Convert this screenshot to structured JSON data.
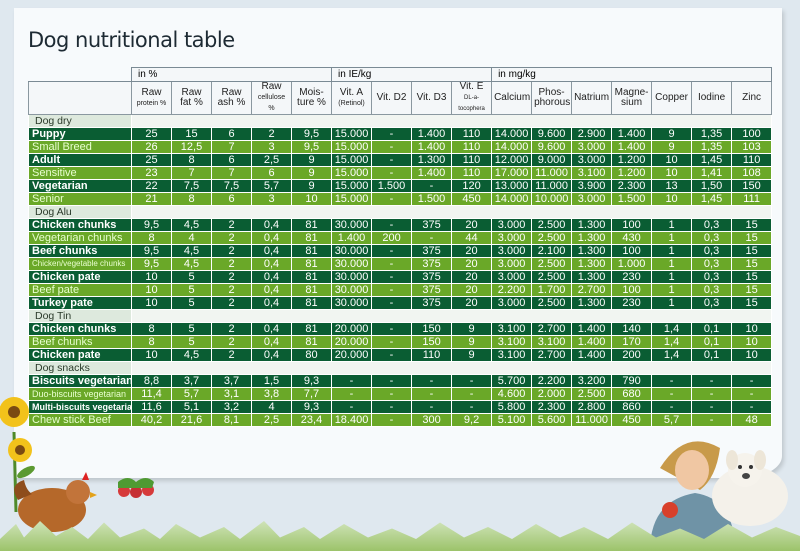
{
  "title": "Dog nutritional table",
  "unit_groups": [
    "in %",
    "in IE/kg",
    "in mg/kg"
  ],
  "columns": [
    {
      "label": "Raw",
      "sub": "protein %",
      "subsize": "sm"
    },
    {
      "label": "Raw",
      "sub": "fat %",
      "subsize": ""
    },
    {
      "label": "Raw",
      "sub": "ash %",
      "subsize": ""
    },
    {
      "label": "Raw",
      "sub": "cellulose %",
      "subsize": "sm"
    },
    {
      "label": "Mois-",
      "sub": "ture %",
      "subsize": ""
    },
    {
      "label": "Vit. A",
      "sub": "(Retinol)",
      "subsize": "sm"
    },
    {
      "label": "Vit. D2",
      "sub": "",
      "subsize": ""
    },
    {
      "label": "Vit. D3",
      "sub": "",
      "subsize": ""
    },
    {
      "label": "Vit. E",
      "sub": "DL-a-tocophera",
      "subsize": "xs"
    },
    {
      "label": "Calcium",
      "sub": "",
      "subsize": ""
    },
    {
      "label": "Phos-",
      "sub": "phorous",
      "subsize": ""
    },
    {
      "label": "Natrium",
      "sub": "",
      "subsize": ""
    },
    {
      "label": "Magne-",
      "sub": "sium",
      "subsize": ""
    },
    {
      "label": "Copper",
      "sub": "",
      "subsize": ""
    },
    {
      "label": "Iodine",
      "sub": "",
      "subsize": ""
    },
    {
      "label": "Zinc",
      "sub": "",
      "subsize": ""
    }
  ],
  "sections": [
    {
      "name": "Dog dry",
      "rows": [
        {
          "name": "Puppy",
          "style": "dark",
          "values": [
            "25",
            "15",
            "6",
            "2",
            "9,5",
            "15.000",
            "-",
            "1.400",
            "110",
            "14.000",
            "9.600",
            "2.900",
            "1.400",
            "9",
            "1,35",
            "100"
          ]
        },
        {
          "name": "Small Breed",
          "style": "light",
          "values": [
            "26",
            "12,5",
            "7",
            "3",
            "9,5",
            "15.000",
            "-",
            "1.400",
            "110",
            "14.000",
            "9.600",
            "3.000",
            "1.400",
            "9",
            "1,35",
            "103"
          ]
        },
        {
          "name": "Adult",
          "style": "dark",
          "values": [
            "25",
            "8",
            "6",
            "2,5",
            "9",
            "15.000",
            "-",
            "1.300",
            "110",
            "12.000",
            "9.000",
            "3.000",
            "1.200",
            "10",
            "1,45",
            "110"
          ]
        },
        {
          "name": "Sensitive",
          "style": "light",
          "values": [
            "23",
            "7",
            "7",
            "6",
            "9",
            "15.000",
            "-",
            "1.400",
            "110",
            "17.000",
            "11.000",
            "3.100",
            "1.200",
            "10",
            "1,41",
            "108"
          ]
        },
        {
          "name": "Vegetarian",
          "style": "dark",
          "values": [
            "22",
            "7,5",
            "7,5",
            "5,7",
            "9",
            "15.000",
            "1.500",
            "-",
            "120",
            "13.000",
            "11.000",
            "3.900",
            "2.300",
            "13",
            "1,50",
            "150"
          ]
        },
        {
          "name": "Senior",
          "style": "light",
          "values": [
            "21",
            "8",
            "6",
            "3",
            "10",
            "15.000",
            "-",
            "1.500",
            "450",
            "14.000",
            "10.000",
            "3.000",
            "1.500",
            "10",
            "1,45",
            "111"
          ]
        }
      ]
    },
    {
      "name": "Dog Alu",
      "rows": [
        {
          "name": "Chicken chunks",
          "style": "dark",
          "values": [
            "9,5",
            "4,5",
            "2",
            "0,4",
            "81",
            "30.000",
            "-",
            "375",
            "20",
            "3.000",
            "2.500",
            "1.300",
            "100",
            "1",
            "0,3",
            "15"
          ]
        },
        {
          "name": "Vegetarian chunks",
          "style": "light",
          "values": [
            "8",
            "4",
            "2",
            "0,4",
            "81",
            "1.400",
            "200",
            "-",
            "44",
            "3.000",
            "2.500",
            "1.300",
            "430",
            "1",
            "0,3",
            "15"
          ]
        },
        {
          "name": "Beef chunks",
          "style": "dark",
          "values": [
            "9,5",
            "4,5",
            "2",
            "0,4",
            "81",
            "30.000",
            "-",
            "375",
            "20",
            "3.000",
            "2.100",
            "1.300",
            "100",
            "1",
            "0,3",
            "15"
          ]
        },
        {
          "name": "Chicken/vegetable chunks",
          "style": "light",
          "size": "tiny",
          "values": [
            "9,5",
            "4,5",
            "2",
            "0,4",
            "81",
            "30.000",
            "-",
            "375",
            "20",
            "3.000",
            "2.500",
            "1.300",
            "1.000",
            "1",
            "0,3",
            "15"
          ]
        },
        {
          "name": "Chicken pate",
          "style": "dark",
          "values": [
            "10",
            "5",
            "2",
            "0,4",
            "81",
            "30.000",
            "-",
            "375",
            "20",
            "3.000",
            "2.500",
            "1.300",
            "230",
            "1",
            "0,3",
            "15"
          ]
        },
        {
          "name": "Beef pate",
          "style": "light",
          "values": [
            "10",
            "5",
            "2",
            "0,4",
            "81",
            "30.000",
            "-",
            "375",
            "20",
            "2.200",
            "1.700",
            "2.700",
            "100",
            "1",
            "0,3",
            "15"
          ]
        },
        {
          "name": "Turkey pate",
          "style": "dark",
          "values": [
            "10",
            "5",
            "2",
            "0,4",
            "81",
            "30.000",
            "-",
            "375",
            "20",
            "3.000",
            "2.500",
            "1.300",
            "230",
            "1",
            "0,3",
            "15"
          ]
        }
      ]
    },
    {
      "name": "Dog Tin",
      "rows": [
        {
          "name": "Chicken chunks",
          "style": "dark",
          "values": [
            "8",
            "5",
            "2",
            "0,4",
            "81",
            "20.000",
            "-",
            "150",
            "9",
            "3.100",
            "2.700",
            "1.400",
            "140",
            "1,4",
            "0,1",
            "10"
          ]
        },
        {
          "name": "Beef chunks",
          "style": "light",
          "values": [
            "8",
            "5",
            "2",
            "0,4",
            "81",
            "20.000",
            "-",
            "150",
            "9",
            "3.100",
            "3.100",
            "1.400",
            "170",
            "1,4",
            "0,1",
            "10"
          ]
        },
        {
          "name": "Chicken pate",
          "style": "dark",
          "values": [
            "10",
            "4,5",
            "2",
            "0,4",
            "80",
            "20.000",
            "-",
            "110",
            "9",
            "3.100",
            "2.700",
            "1.400",
            "200",
            "1,4",
            "0,1",
            "10"
          ]
        }
      ]
    },
    {
      "name": "Dog snacks",
      "rows": [
        {
          "name": "Biscuits vegetarian",
          "style": "dark",
          "values": [
            "8,8",
            "3,7",
            "3,7",
            "1,5",
            "9,3",
            "-",
            "-",
            "-",
            "-",
            "5.700",
            "2.200",
            "3.200",
            "790",
            "-",
            "-",
            "-"
          ]
        },
        {
          "name": "Duo-biscuits vegetarian",
          "style": "light",
          "size": "small",
          "values": [
            "11,4",
            "5,7",
            "3,1",
            "3,8",
            "7,7",
            "-",
            "-",
            "-",
            "-",
            "4.600",
            "2.000",
            "2.500",
            "680",
            "-",
            "-",
            "-"
          ]
        },
        {
          "name": "Multi-biscuits vegetarian",
          "style": "dark",
          "size": "small",
          "values": [
            "11,6",
            "5,1",
            "3,2",
            "4",
            "9,3",
            "-",
            "-",
            "-",
            "-",
            "5.800",
            "2.300",
            "2.800",
            "860",
            "-",
            "-",
            "-"
          ]
        },
        {
          "name": "Chew stick Beef",
          "style": "light",
          "values": [
            "40,2",
            "21,6",
            "8,1",
            "2,5",
            "23,4",
            "18.400",
            "-",
            "300",
            "9,2",
            "5.100",
            "5.600",
            "11.000",
            "450",
            "5,7",
            "-",
            "48"
          ]
        }
      ]
    }
  ],
  "colors": {
    "dark_row": "#0a5d33",
    "light_row": "#6aa828",
    "section_row": "#dde9dd"
  }
}
